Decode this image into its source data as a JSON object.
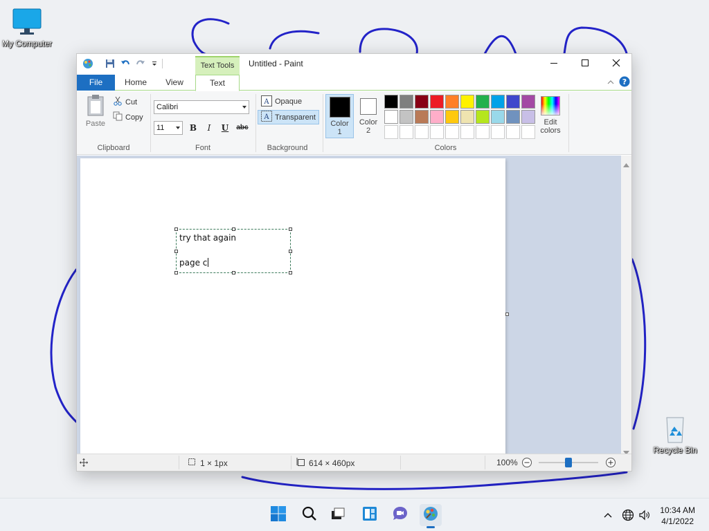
{
  "desktop": {
    "icons": [
      {
        "label": "My Computer"
      },
      {
        "label": "Recycle Bin"
      }
    ]
  },
  "window": {
    "title": "Untitled - Paint",
    "context_tab_header": "Text Tools",
    "tabs": [
      {
        "label": "File"
      },
      {
        "label": "Home"
      },
      {
        "label": "View"
      },
      {
        "label": "Text"
      }
    ]
  },
  "ribbon": {
    "clipboard": {
      "group_label": "Clipboard",
      "paste": "Paste",
      "cut": "Cut",
      "copy": "Copy"
    },
    "font": {
      "group_label": "Font",
      "family": "Calibri",
      "size": "11",
      "bold": "B",
      "italic": "I",
      "underline": "U",
      "strikethrough": "abc"
    },
    "background": {
      "group_label": "Background",
      "opaque": "Opaque",
      "transparent": "Transparent"
    },
    "colors": {
      "group_label": "Colors",
      "color1_label": "Color",
      "color1_num": "1",
      "color2_label": "Color",
      "color2_num": "2",
      "edit_colors_line1": "Edit",
      "edit_colors_line2": "colors",
      "color1": "#000000",
      "color2": "#ffffff",
      "palette_row1": [
        "#000000",
        "#7f7f7f",
        "#880015",
        "#ed1c24",
        "#ff7f27",
        "#fff200",
        "#22b14c",
        "#00a2e8",
        "#3f48cc",
        "#a349a4"
      ],
      "palette_row2": [
        "#ffffff",
        "#c3c3c3",
        "#b97a57",
        "#ffaec9",
        "#ffc90e",
        "#efe4b0",
        "#b5e61d",
        "#99d9ea",
        "#7092be",
        "#c8bfe7"
      ]
    }
  },
  "canvas": {
    "text_lines": [
      "try that again",
      "page c"
    ]
  },
  "statusbar": {
    "selection_size": "1 × 1px",
    "image_size": "614 × 460px",
    "zoom": "100%",
    "zoom_slider_level": 0.5
  },
  "taskbar": {
    "time": "10:34 AM",
    "date": "4/1/2022"
  }
}
